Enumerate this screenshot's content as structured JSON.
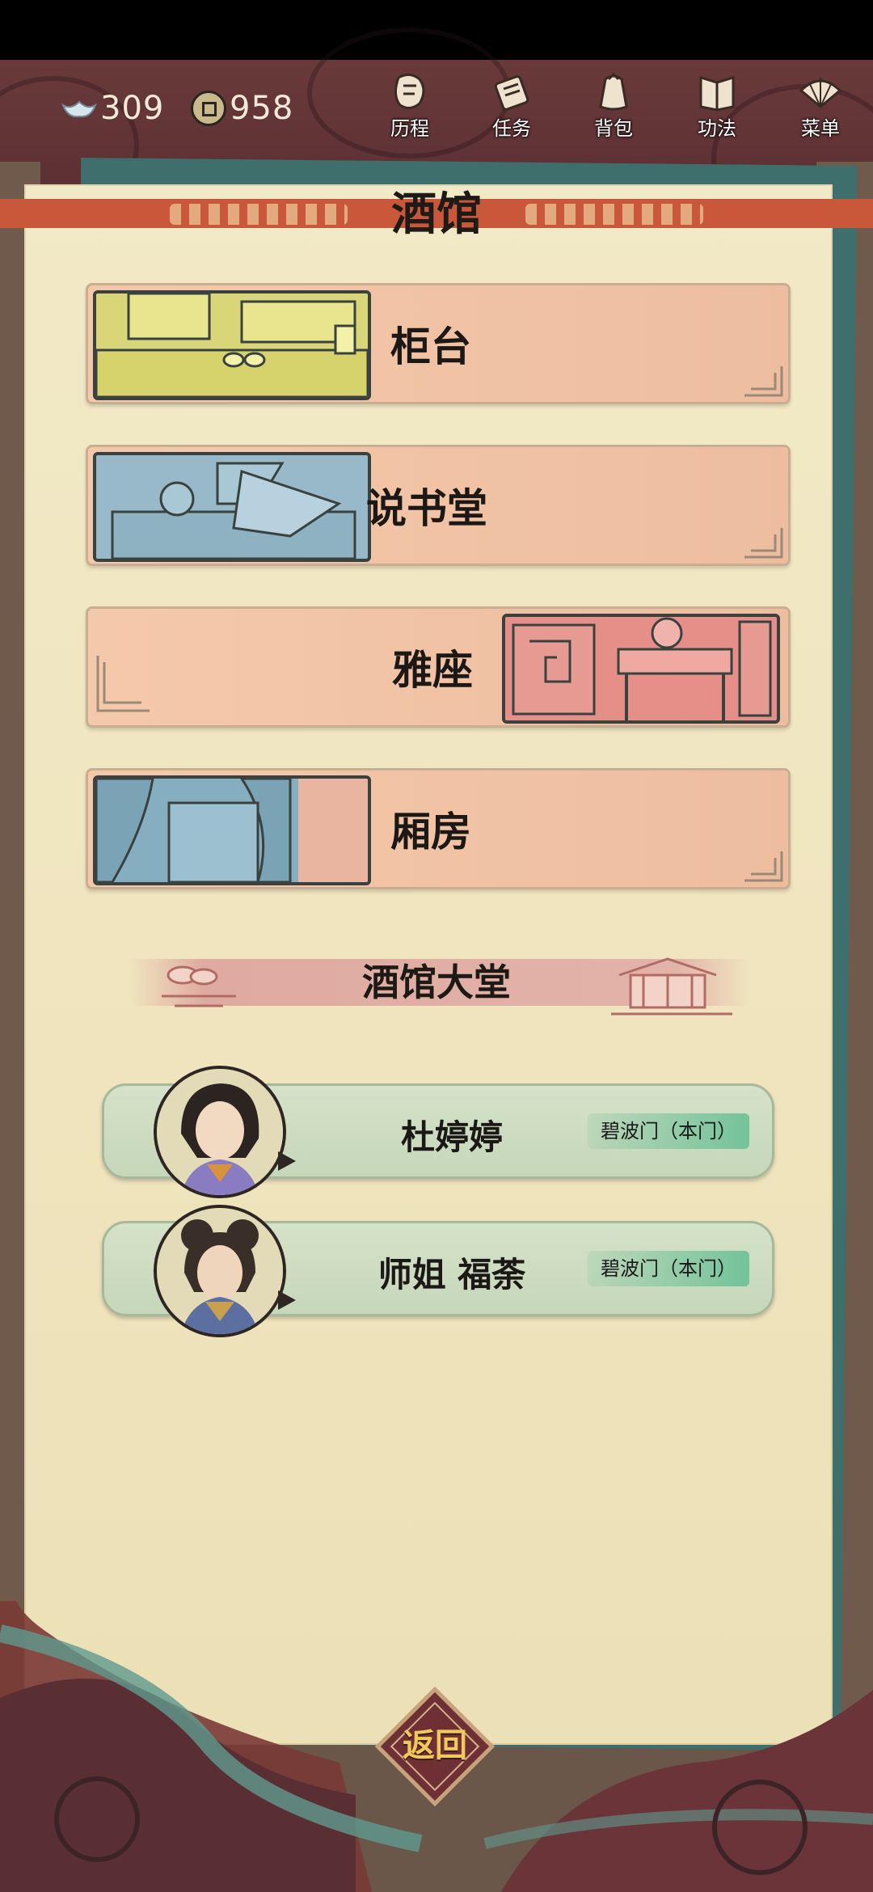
{
  "header": {
    "currency": [
      {
        "icon": "silver-ingot-icon",
        "value": "309"
      },
      {
        "icon": "copper-coin-icon",
        "value": "958"
      }
    ],
    "nav": [
      {
        "icon": "history-icon",
        "label": "历程"
      },
      {
        "icon": "task-scroll-icon",
        "label": "任务"
      },
      {
        "icon": "backpack-icon",
        "label": "背包"
      },
      {
        "icon": "book-icon",
        "label": "功法"
      },
      {
        "icon": "fan-menu-icon",
        "label": "菜单"
      }
    ]
  },
  "page": {
    "title": "酒馆"
  },
  "rooms": [
    {
      "label": "柜台"
    },
    {
      "label": "说书堂"
    },
    {
      "label": "雅座"
    },
    {
      "label": "厢房"
    }
  ],
  "hall": {
    "title": "酒馆大堂",
    "npcs": [
      {
        "name": "杜婷婷",
        "sect": "碧波门（本门）"
      },
      {
        "name": "师姐 福荼",
        "sect": "碧波门（本门）"
      }
    ]
  },
  "footer": {
    "back_label": "返回"
  },
  "colors": {
    "paper": "#f2e9c7",
    "ribbon": "#c9573a",
    "room_bg": "#f4c9a9",
    "npc_bg": "#d5e2c9",
    "sect_badge": "#73c39a",
    "top_band": "#5a2f33",
    "teal": "#3e6f6c"
  }
}
